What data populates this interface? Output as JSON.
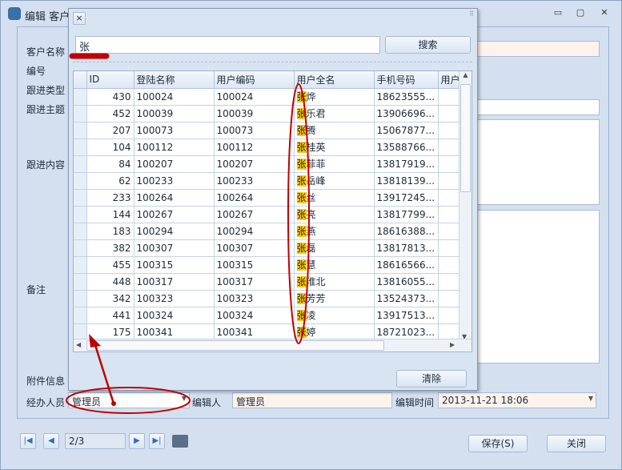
{
  "window": {
    "title": "编辑 客户跟进",
    "min": "▭",
    "max": "▢",
    "close": "✕"
  },
  "form": {
    "labels": {
      "customer_name": "客户名称",
      "number": "编号",
      "type": "跟进类型",
      "subject": "跟进主题",
      "content": "跟进内容",
      "remark": "备注",
      "attachment": "附件信息",
      "handler": "经办人员",
      "editor": "编辑人",
      "edit_time": "编辑时间"
    },
    "handler_value": "管理员",
    "editor_value": "管理员",
    "edit_time_value": "2013-11-21 18:06"
  },
  "nav": {
    "page": "2/3",
    "save": "保存(S)",
    "close": "关闭"
  },
  "popup": {
    "close": "×",
    "search_value": "张",
    "search_button": "搜索",
    "clear_button": "清除",
    "columns": [
      "ID",
      "登陆名称",
      "用户编码",
      "用户全名",
      "手机号码",
      "用户"
    ],
    "rows": [
      [
        "430",
        "100024",
        "100024",
        "张",
        "烨",
        "18623555..."
      ],
      [
        "452",
        "100039",
        "100039",
        "张",
        "乐君",
        "13906696..."
      ],
      [
        "207",
        "100073",
        "100073",
        "张",
        "腾",
        "15067877..."
      ],
      [
        "104",
        "100112",
        "100112",
        "张",
        "桂英",
        "13588766..."
      ],
      [
        "84",
        "100207",
        "100207",
        "张",
        "菲菲",
        "13817919..."
      ],
      [
        "62",
        "100233",
        "100233",
        "张",
        "岳峰",
        "13818139..."
      ],
      [
        "233",
        "100264",
        "100264",
        "张",
        "丝",
        "13917245..."
      ],
      [
        "144",
        "100267",
        "100267",
        "张",
        "亮",
        "13817799..."
      ],
      [
        "183",
        "100294",
        "100294",
        "张",
        "燕",
        "18616388..."
      ],
      [
        "382",
        "100307",
        "100307",
        "张",
        "磊",
        "13817813..."
      ],
      [
        "455",
        "100315",
        "100315",
        "张",
        "慧",
        "18616566..."
      ],
      [
        "448",
        "100317",
        "100317",
        "张",
        "淮北",
        "13816055..."
      ],
      [
        "342",
        "100323",
        "100323",
        "张",
        "芳芳",
        "13524373..."
      ],
      [
        "441",
        "100324",
        "100324",
        "张",
        "凌",
        "13917513..."
      ],
      [
        "175",
        "100341",
        "100341",
        "张",
        "婷",
        "18721023..."
      ]
    ]
  },
  "colors": {
    "highlight": "#ffc800",
    "annotation": "#c00000"
  }
}
